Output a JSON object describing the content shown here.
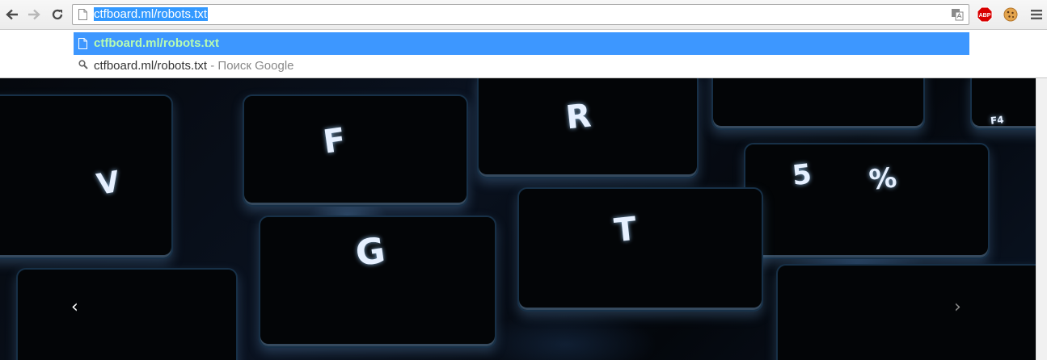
{
  "browser": {
    "address": {
      "url": "ctfboard.ml/robots.txt"
    },
    "extensions": {
      "abp_label": "ABP"
    }
  },
  "omnibox_dropdown": {
    "items": [
      {
        "text": "ctfboard.ml/robots.txt",
        "icon": "page-icon"
      },
      {
        "text": "ctfboard.ml/robots.txt",
        "separator": " - ",
        "subtext": "Поиск Google",
        "icon": "search-icon"
      }
    ]
  },
  "page": {
    "carousel": {
      "prev_label": "‹",
      "next_label": "›",
      "key_glyphs": [
        "F",
        "R",
        "V",
        "G",
        "T",
        "5",
        "%",
        "F4"
      ]
    }
  },
  "colors": {
    "selection": "#3399ff",
    "dropdown_selected_bg": "#3d97ff",
    "dropdown_selected_text": "#b6fbb2",
    "abp_red": "#d80000"
  }
}
